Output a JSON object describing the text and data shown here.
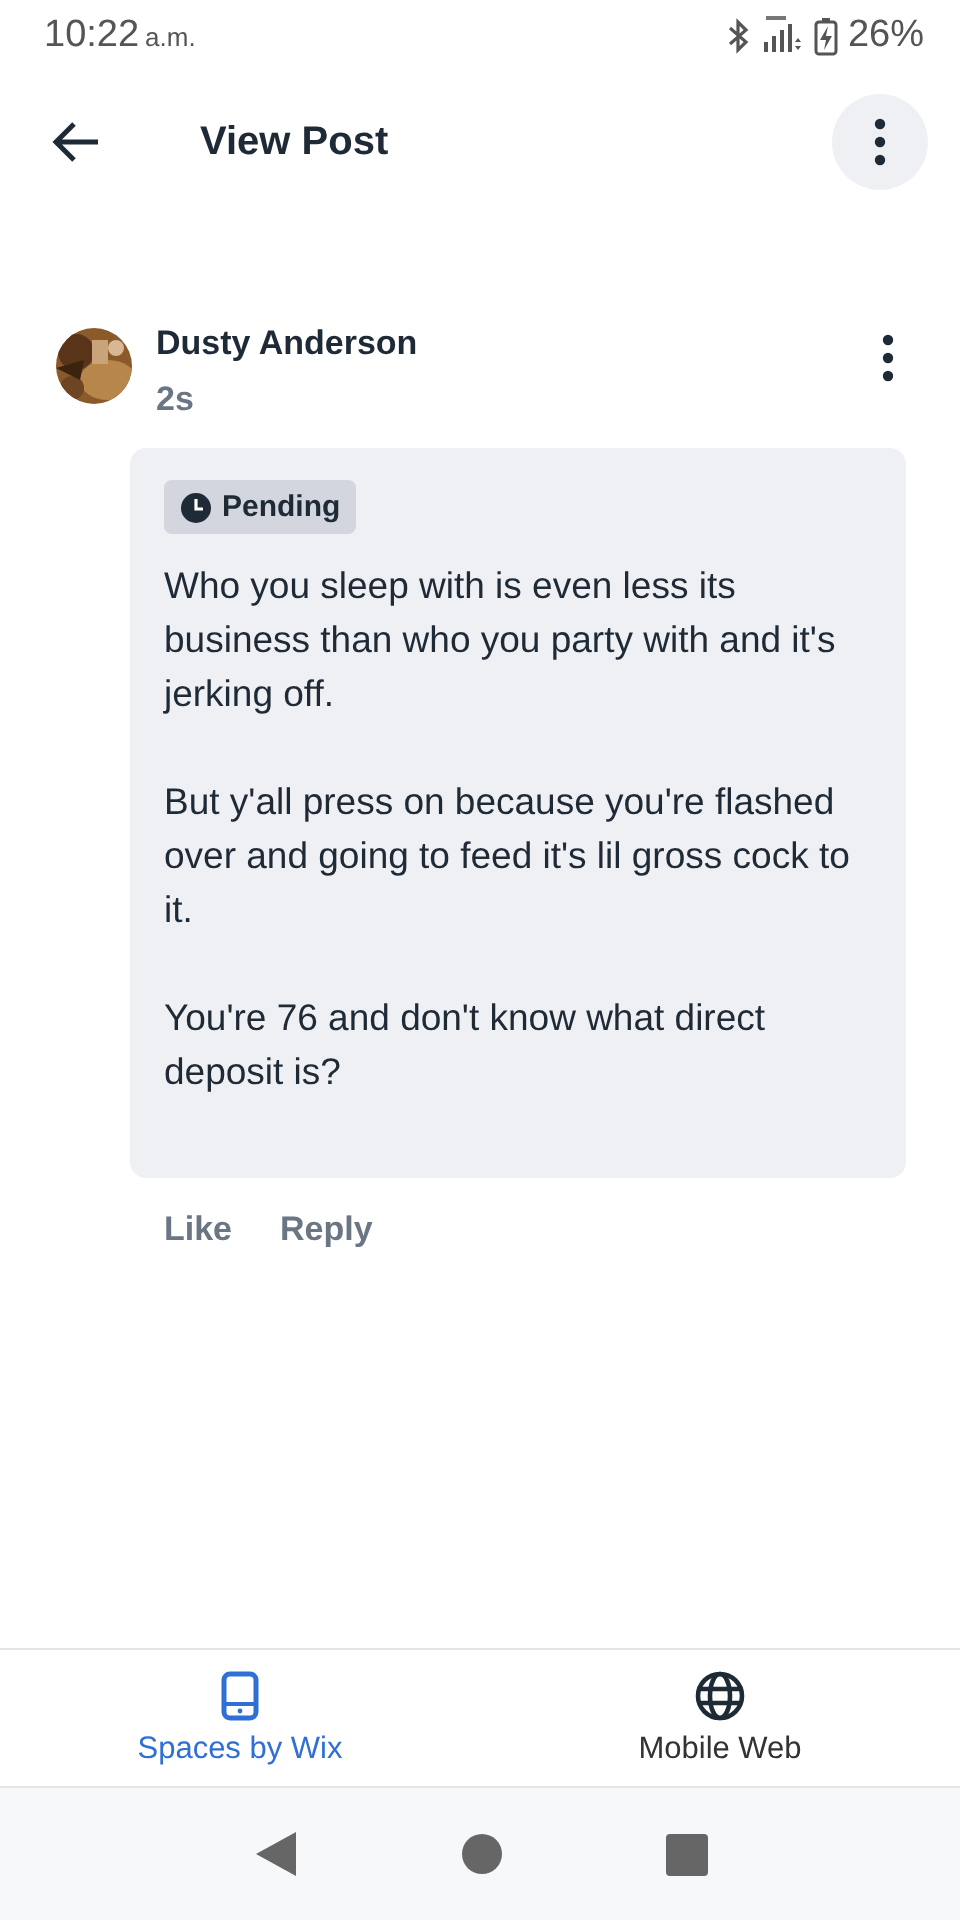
{
  "status_bar": {
    "time": "10:22",
    "meridiem": "a.m.",
    "battery": "26%"
  },
  "header": {
    "title": "View Post"
  },
  "comment": {
    "author": "Dusty Anderson",
    "age": "2s",
    "badge": "Pending",
    "paragraphs": [
      "Who you sleep with is even less its business than who you party with and it's jerking off.",
      "But y'all press on because you're flashed over and going to feed it's lil gross cock to it.",
      "You're 76 and don't know what direct deposit is?"
    ],
    "actions": [
      "Like",
      "Reply"
    ]
  },
  "bottom_tabs": [
    {
      "label": "Spaces by Wix",
      "kind": "phone",
      "selected": true
    },
    {
      "label": "Mobile Web",
      "kind": "globe",
      "selected": false
    }
  ]
}
